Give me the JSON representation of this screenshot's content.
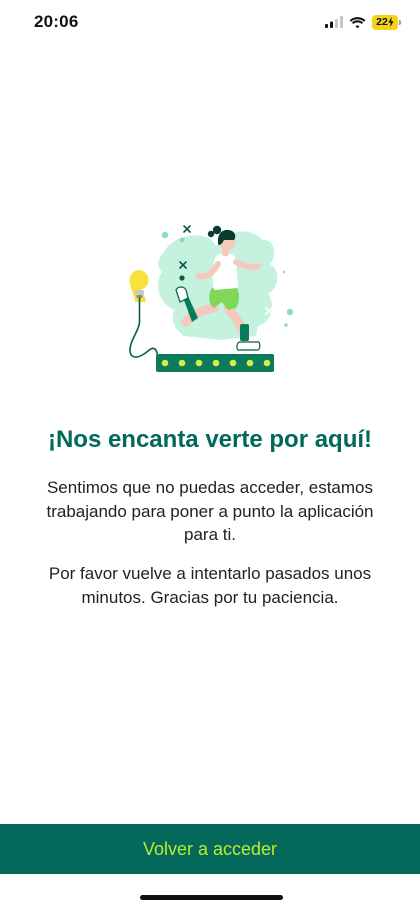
{
  "status_bar": {
    "time": "20:06",
    "battery_level": "22",
    "battery_charging": true,
    "signal_icon": "cellular-signal-icon",
    "wifi_icon": "wifi-icon"
  },
  "illustration": {
    "icon": "runner-on-treadmill-illustration"
  },
  "content": {
    "title": "¡Nos encanta verte por aquí!",
    "message_1": "Sentimos que no puedas acceder, estamos trabajando para poner a punto la aplicación para ti.",
    "message_2": "Por favor vuelve a intentarlo pasados unos minutos. Gracias por tu paciencia."
  },
  "actions": {
    "retry_label": "Volver a acceder"
  },
  "colors": {
    "primary": "#04695a",
    "accent": "#b7ef2e",
    "title": "#00695a",
    "mint": "#c5f1df",
    "bulb": "#f7e23a"
  }
}
